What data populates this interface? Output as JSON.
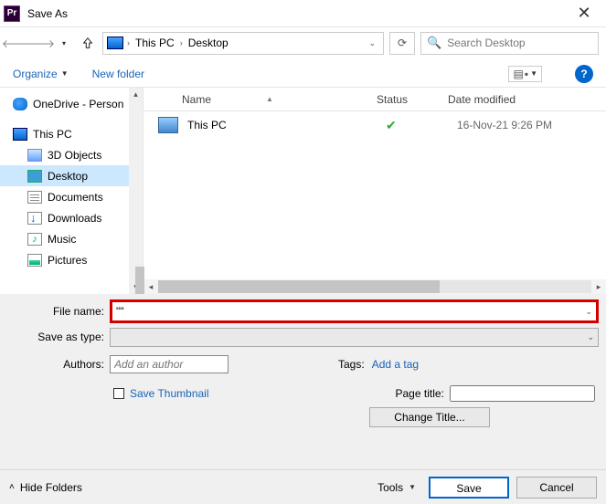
{
  "title": "Save As",
  "app_icon": "Pr",
  "nav": {
    "crumbs": [
      "This PC",
      "Desktop"
    ],
    "search_placeholder": "Search Desktop"
  },
  "toolbar": {
    "organize": "Organize",
    "new_folder": "New folder"
  },
  "tree": [
    {
      "label": "OneDrive - Person",
      "icon": "cloud",
      "indent": false
    },
    {
      "label": "This PC",
      "icon": "pc",
      "indent": false,
      "gap": true
    },
    {
      "label": "3D Objects",
      "icon": "3d",
      "indent": true
    },
    {
      "label": "Desktop",
      "icon": "desk",
      "indent": true,
      "selected": true
    },
    {
      "label": "Documents",
      "icon": "doc",
      "indent": true
    },
    {
      "label": "Downloads",
      "icon": "dl",
      "indent": true
    },
    {
      "label": "Music",
      "icon": "music",
      "indent": true
    },
    {
      "label": "Pictures",
      "icon": "pic",
      "indent": true
    }
  ],
  "columns": {
    "name": "Name",
    "status": "Status",
    "date": "Date modified"
  },
  "rows": [
    {
      "name": "This PC",
      "status": "✔",
      "date": "16-Nov-21 9:26 PM"
    }
  ],
  "labels": {
    "file_name": "File name:",
    "save_type": "Save as type:",
    "authors": "Authors:",
    "authors_ph": "Add an author",
    "tags": "Tags:",
    "add_tag": "Add a tag",
    "save_thumb": "Save Thumbnail",
    "page_title": "Page title:",
    "change_title": "Change Title...",
    "tools": "Tools",
    "save": "Save",
    "cancel": "Cancel",
    "hide_folders": "Hide Folders"
  },
  "file_name_value": "\"\""
}
